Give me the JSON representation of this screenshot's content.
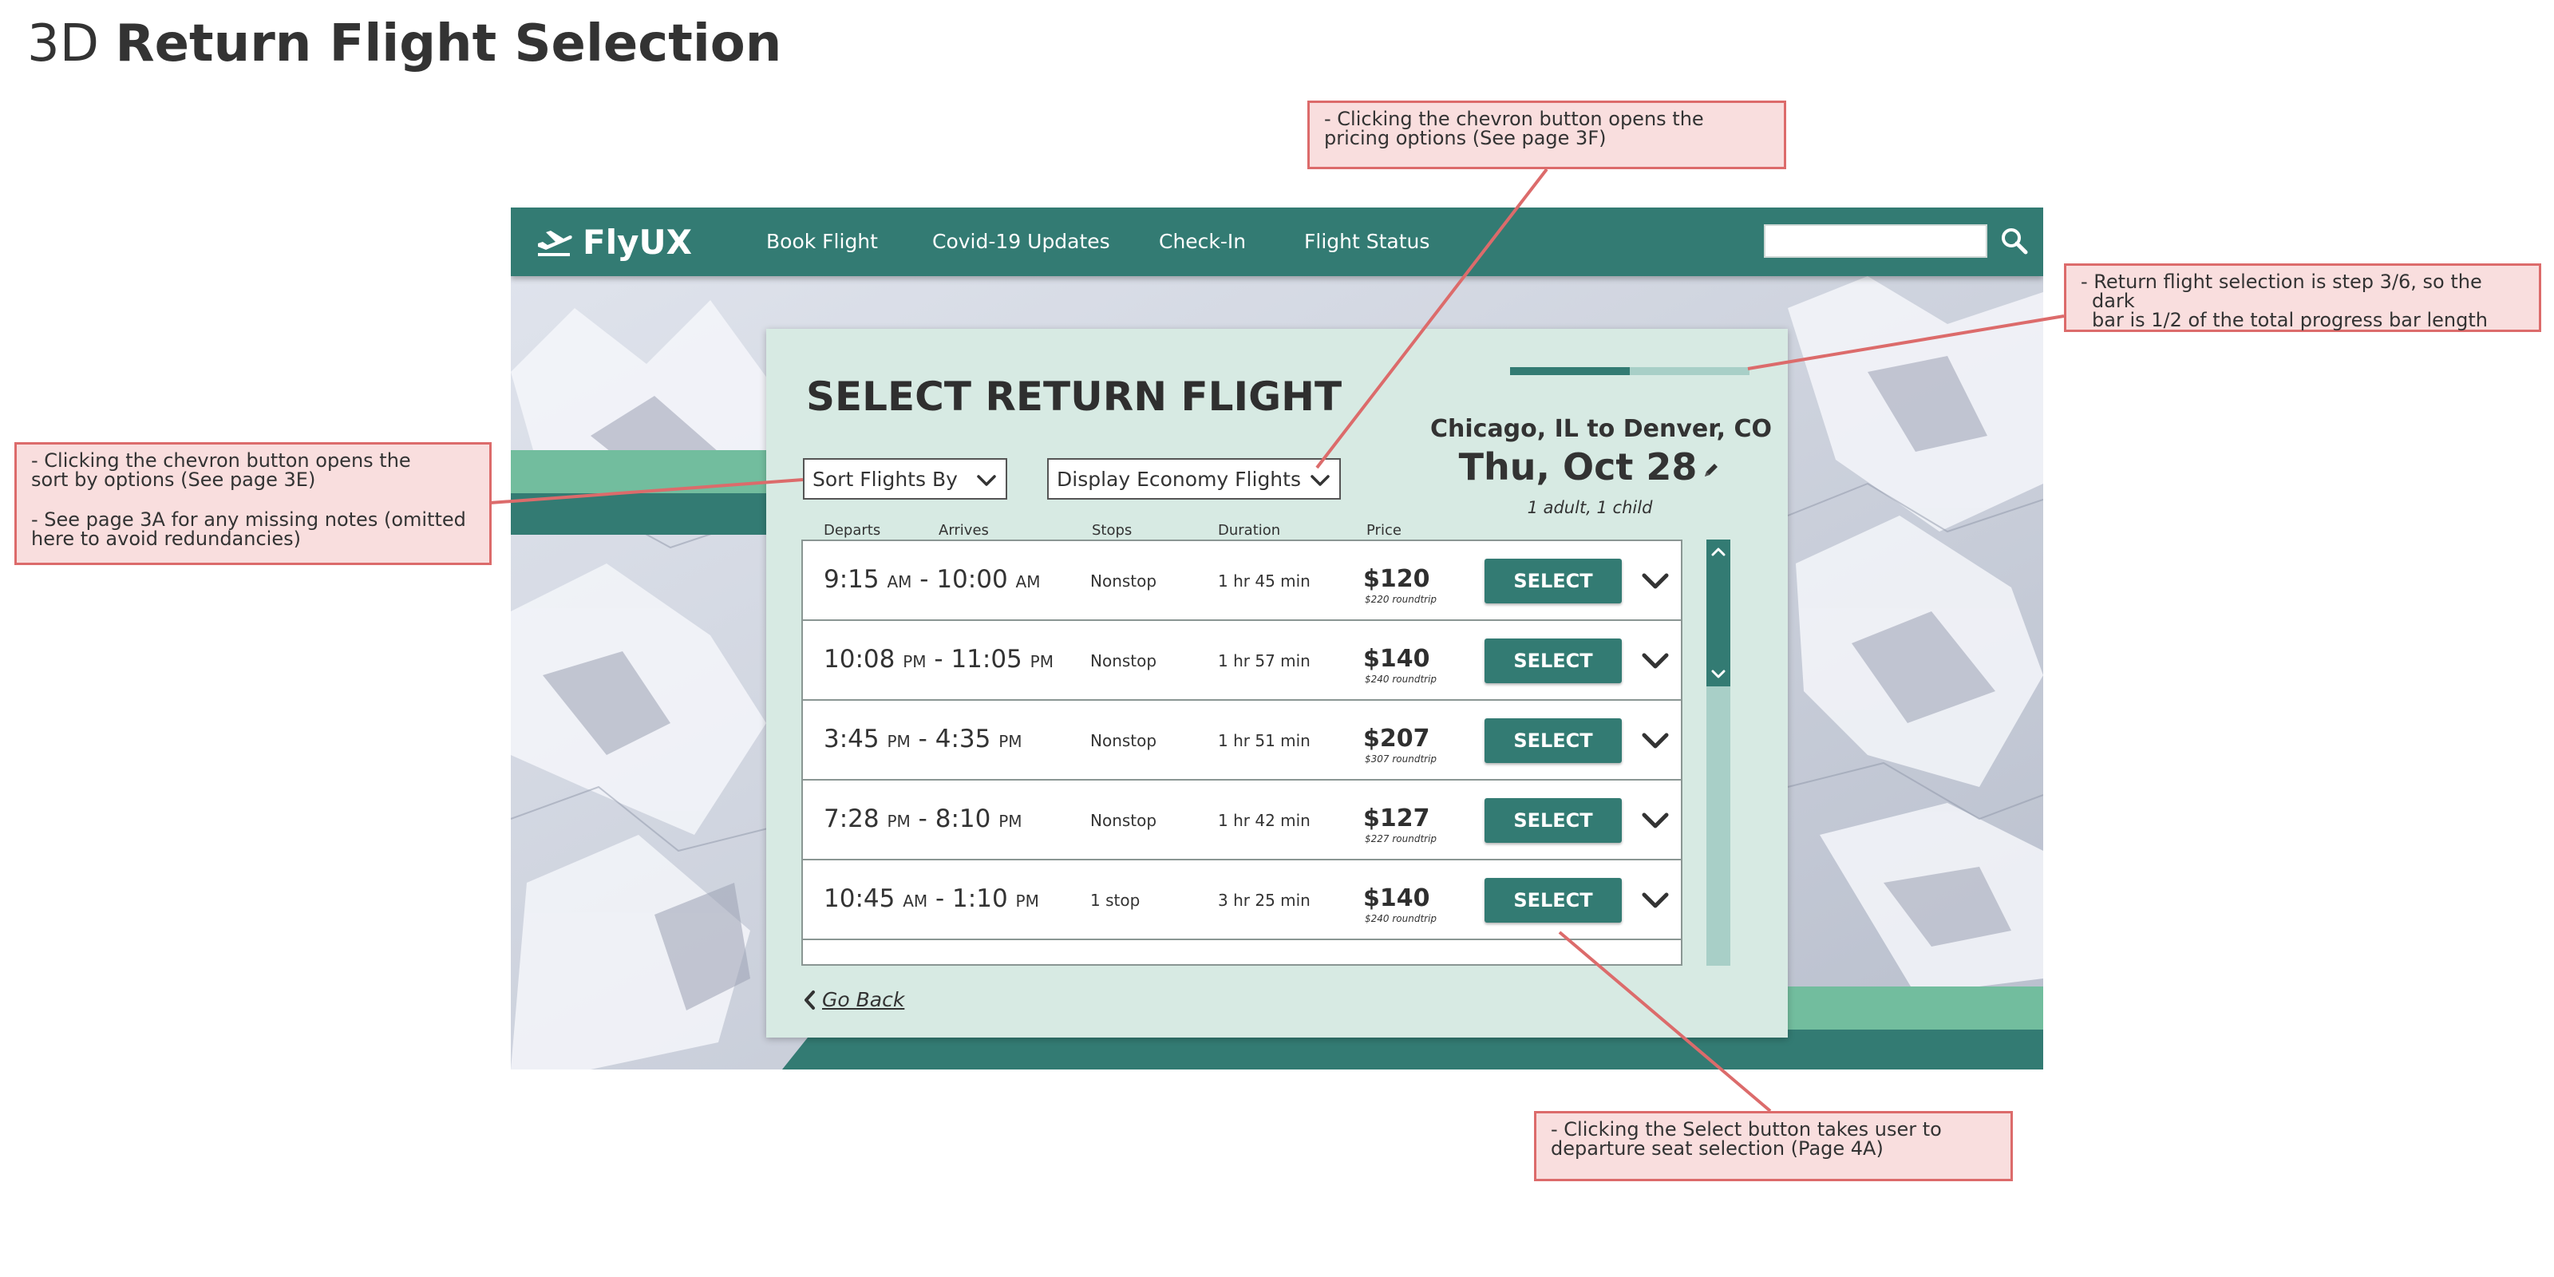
{
  "page": {
    "id": "3D",
    "title": "Return Flight Selection"
  },
  "annotations": {
    "sort": {
      "line1": "- Clicking the chevron button opens the",
      "line2": "sort by options (See page 3E)",
      "line3": "- See page 3A for any missing notes (omitted",
      "line4": "here to avoid redundancies)"
    },
    "pricing": {
      "line1": "- Clicking the chevron button opens the",
      "line2": "pricing options (See page 3F)"
    },
    "progress": {
      "line1": "- Return flight selection is step 3/6, so the dark",
      "line2": "bar is 1/2 of the total progress bar length"
    },
    "select": {
      "line1": "- Clicking the Select button takes user to",
      "line2": "departure seat selection (Page 4A)"
    }
  },
  "app": {
    "logo_text": "FlyUX",
    "logo_icon": "plane-takeoff-icon",
    "nav": {
      "book_flight": "Book Flight",
      "covid": "Covid-19 Updates",
      "check_in": "Check-In",
      "flight_status": "Flight Status"
    },
    "search": {
      "placeholder": "",
      "icon": "search-icon"
    }
  },
  "panel": {
    "heading": "SELECT RETURN FLIGHT",
    "progress": {
      "step": 3,
      "total": 6,
      "fraction": 0.5
    },
    "route": "Chicago, IL to Denver, CO",
    "date": "Thu, Oct 28",
    "passengers": "1 adult, 1 child",
    "sort_dropdown": "Sort Flights By",
    "class_dropdown": "Display Economy Flights",
    "columns": {
      "departs": "Departs",
      "arrives": "Arrives",
      "stops": "Stops",
      "duration": "Duration",
      "price": "Price"
    },
    "select_label": "SELECT",
    "go_back": "Go Back"
  },
  "flights": [
    {
      "dep": "9:15",
      "dep_ampm": "AM",
      "sep": " - ",
      "arr": "10:00",
      "arr_ampm": "AM",
      "stops": "Nonstop",
      "duration": "1 hr 45 min",
      "price": "$120",
      "roundtrip": "$220 roundtrip"
    },
    {
      "dep": "10:08",
      "dep_ampm": "PM",
      "sep": " - ",
      "arr": "11:05",
      "arr_ampm": "PM",
      "stops": "Nonstop",
      "duration": "1 hr 57 min",
      "price": "$140",
      "roundtrip": "$240 roundtrip"
    },
    {
      "dep": "3:45",
      "dep_ampm": "PM",
      "sep": " - ",
      "arr": "4:35",
      "arr_ampm": "PM",
      "stops": "Nonstop",
      "duration": "1 hr 51 min",
      "price": "$207",
      "roundtrip": "$307 roundtrip"
    },
    {
      "dep": "7:28",
      "dep_ampm": "PM",
      "sep": " - ",
      "arr": "8:10",
      "arr_ampm": "PM",
      "stops": "Nonstop",
      "duration": "1 hr 42 min",
      "price": "$127",
      "roundtrip": "$227 roundtrip"
    },
    {
      "dep": "10:45",
      "dep_ampm": "AM",
      "sep": " - ",
      "arr": "1:10",
      "arr_ampm": "PM",
      "stops": "1 stop",
      "duration": "3 hr 25 min",
      "price": "$140",
      "roundtrip": "$240 roundtrip"
    }
  ],
  "colors": {
    "brand_dark": "#337b73",
    "brand_light": "#72bd9e",
    "panel_bg": "#d7eae3",
    "progress_track": "#a8cfc7",
    "annotation_bg": "#f9dede",
    "annotation_border": "#dc6b6b"
  }
}
